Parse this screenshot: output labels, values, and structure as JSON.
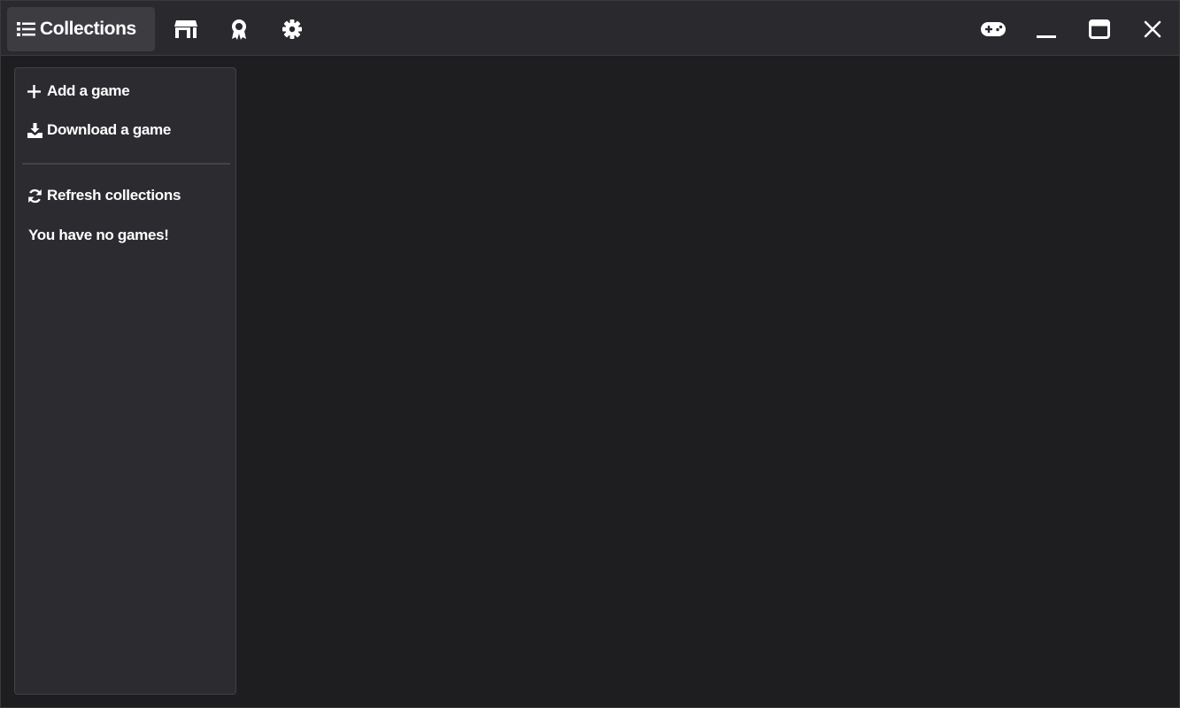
{
  "titlebar": {
    "tabs": [
      {
        "label": "Collections",
        "icon": "list-icon",
        "active": true
      },
      {
        "label": "",
        "icon": "store-icon"
      },
      {
        "label": "",
        "icon": "award-icon"
      },
      {
        "label": "",
        "icon": "gear-icon"
      }
    ],
    "window_controls": [
      "gamepad-icon",
      "minimize-icon",
      "maximize-icon",
      "close-icon"
    ]
  },
  "sidebar": {
    "add_game": "Add a game",
    "download_game": "Download a game",
    "refresh": "Refresh collections",
    "empty_message": "You have no games!"
  },
  "colors": {
    "background": "#1e1d20",
    "titlebar": "#2a292d",
    "active_tab": "#3d3c41",
    "sidebar": "#2c2b2f",
    "text": "#ffffff"
  }
}
